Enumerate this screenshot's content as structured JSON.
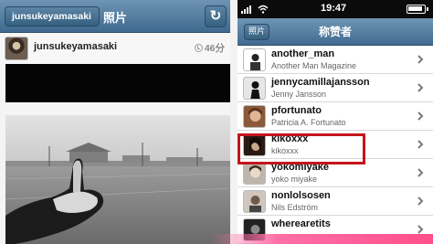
{
  "left": {
    "nav": {
      "back_label": "junsukeyamasaki",
      "title": "照片",
      "refresh_icon": "refresh-icon"
    },
    "post": {
      "username": "junsukeyamasaki",
      "time_ago": "46分"
    }
  },
  "right": {
    "status_bar": {
      "time": "19:47"
    },
    "nav": {
      "back_label": "照片",
      "title": "称赞者"
    },
    "likers": [
      {
        "username": "another_man",
        "fullname": "Another Man Magazine",
        "avatar_color": "#ffffff"
      },
      {
        "username": "jennycamillajansson",
        "fullname": "Jenny Jansson",
        "avatar_color": "#d8d8d8"
      },
      {
        "username": "pfortunato",
        "fullname": "Patricia A. Fortunato",
        "avatar_color": "#8a5a3a"
      },
      {
        "username": "kikoxxx",
        "fullname": "kikoxxx",
        "avatar_color": "#2a1a14",
        "highlighted": true
      },
      {
        "username": "yokomiyake",
        "fullname": "yoko miyake",
        "avatar_color": "#bdb6ac"
      },
      {
        "username": "nonlolsosen",
        "fullname": "Nils Edström",
        "avatar_color": "#cfc7bd"
      },
      {
        "username": "wherearetits",
        "fullname": "",
        "avatar_color": "#222222"
      }
    ],
    "highlight_color": "#c4151c"
  }
}
